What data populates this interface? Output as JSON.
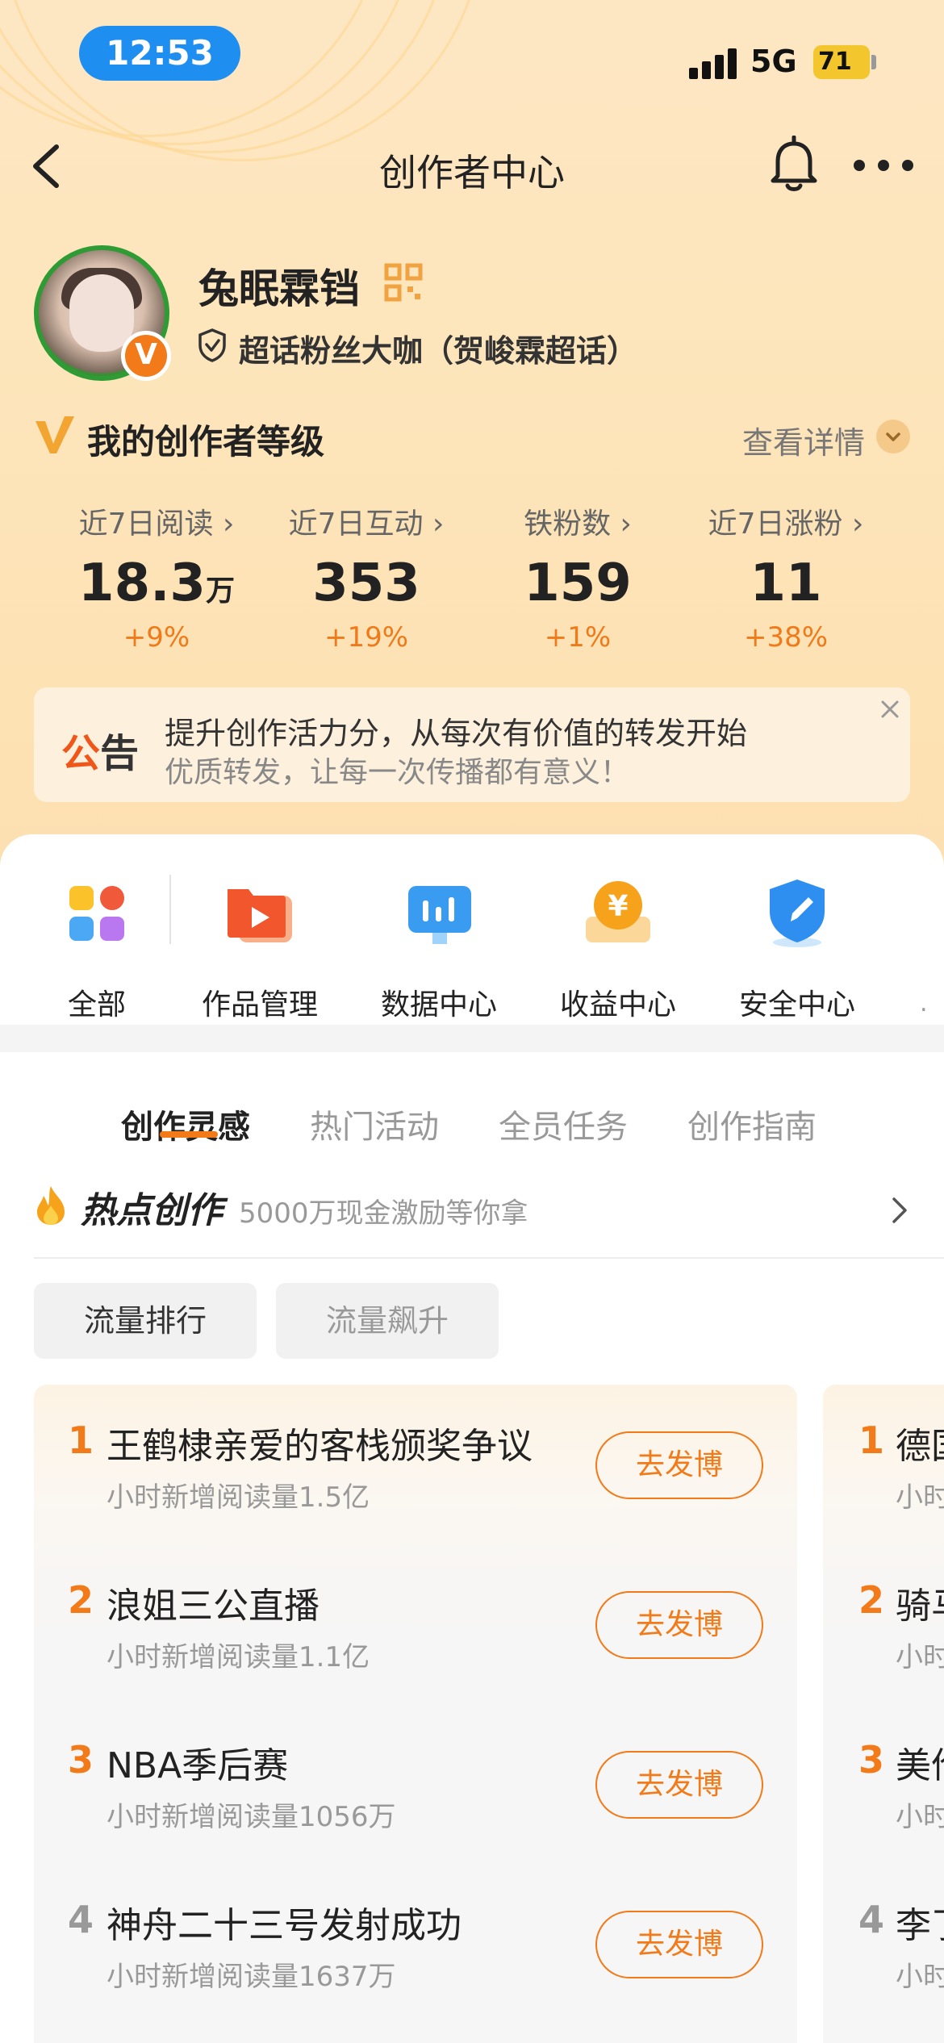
{
  "status_bar": {
    "time": "12:53",
    "network": "5G",
    "battery": "71"
  },
  "nav": {
    "title": "创作者中心"
  },
  "profile": {
    "username": "兔眠霖铛",
    "badge": "V",
    "fan_title": "超话粉丝大咖（贺峻霖超话）"
  },
  "level": {
    "title": "我的创作者等级",
    "detail_link": "查看详情"
  },
  "stats": [
    {
      "label": "近7日阅读 ›",
      "value": "18.3",
      "unit": "万",
      "change": "+9%"
    },
    {
      "label": "近7日互动 ›",
      "value": "353",
      "unit": "",
      "change": "+19%"
    },
    {
      "label": "铁粉数 ›",
      "value": "159",
      "unit": "",
      "change": "+1%"
    },
    {
      "label": "近7日涨粉 ›",
      "value": "11",
      "unit": "",
      "change": "+38%"
    }
  ],
  "notice": {
    "tag_first": "公",
    "tag_second": "告",
    "line1": "提升创作活力分，从每次有价值的转发开始",
    "line2": "优质转发，让每一次传播都有意义！"
  },
  "quick_actions": [
    {
      "label": "全部",
      "icon": "grid-icon"
    },
    {
      "label": "作品管理",
      "icon": "play-folder-icon"
    },
    {
      "label": "数据中心",
      "icon": "chart-icon"
    },
    {
      "label": "收益中心",
      "icon": "coin-icon"
    },
    {
      "label": "安全中心",
      "icon": "shield-icon"
    }
  ],
  "quick_more": ".",
  "tabs": [
    {
      "label": "创作灵感",
      "active": true
    },
    {
      "label": "热门活动",
      "active": false
    },
    {
      "label": "全员任务",
      "active": false
    },
    {
      "label": "创作指南",
      "active": false
    }
  ],
  "hot": {
    "title": "热点创作",
    "subtitle": "5000万现金激励等你拿"
  },
  "pills": {
    "active": "流量排行",
    "inactive": "流量飙升"
  },
  "hot_list": [
    {
      "rank": "1",
      "title": "王鹤棣亲爱的客栈颁奖争议",
      "meta": "小时新增阅读量1.5亿",
      "button": "去发博"
    },
    {
      "rank": "2",
      "title": "浪姐三公直播",
      "meta": "小时新增阅读量1.1亿",
      "button": "去发博"
    },
    {
      "rank": "3",
      "title": "NBA季后赛",
      "meta": "小时新增阅读量1056万",
      "button": "去发博"
    },
    {
      "rank": "4",
      "title": "神舟二十三号发射成功",
      "meta": "小时新增阅读量1637万",
      "button": "去发博"
    }
  ],
  "hot_list_next": [
    {
      "rank": "1",
      "title": "德国",
      "meta": "小时"
    },
    {
      "rank": "2",
      "title": "骑马",
      "meta": "小时"
    },
    {
      "rank": "3",
      "title": "美伦",
      "meta": "小时"
    },
    {
      "rank": "4",
      "title": "李了",
      "meta": "小时"
    }
  ],
  "colors": {
    "accent": "#f27a18",
    "status_pill": "#1f8ef1",
    "header_bg": "#fde5bb"
  }
}
